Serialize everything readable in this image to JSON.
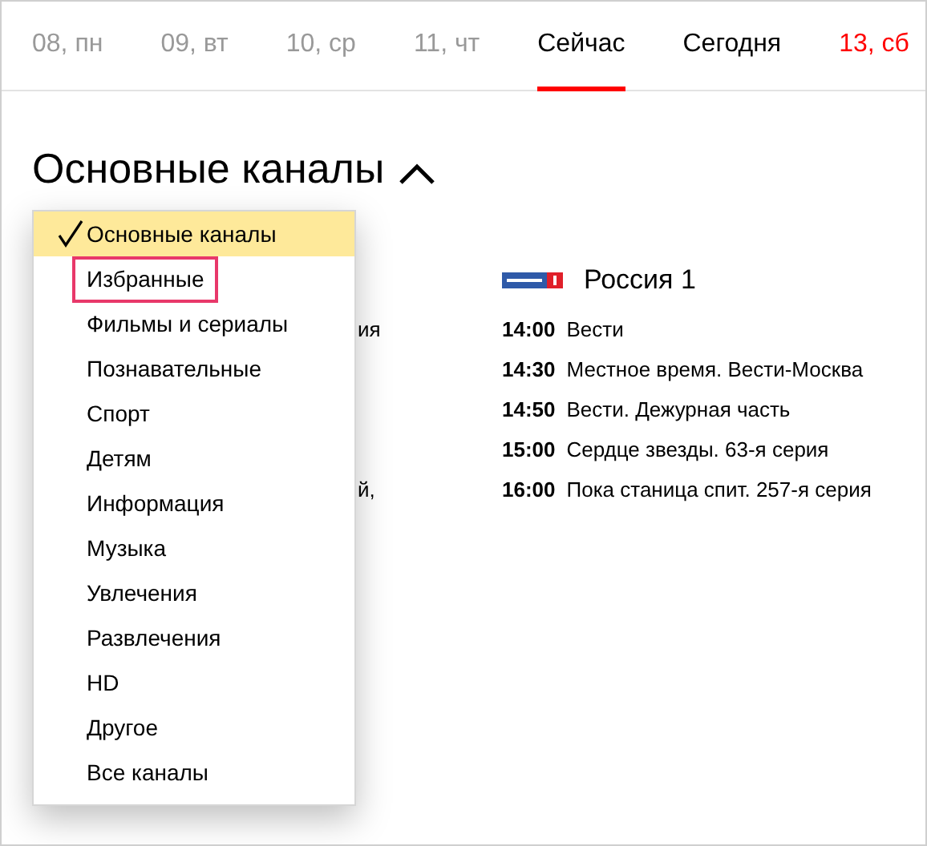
{
  "tabs": [
    {
      "label": "08, пн",
      "kind": "past",
      "selected": false
    },
    {
      "label": "09, вт",
      "kind": "past",
      "selected": false
    },
    {
      "label": "10, ср",
      "kind": "past",
      "selected": false
    },
    {
      "label": "11, чт",
      "kind": "past",
      "selected": false
    },
    {
      "label": "Сейчас",
      "kind": "normal",
      "selected": true
    },
    {
      "label": "Сегодня",
      "kind": "normal",
      "selected": false
    },
    {
      "label": "13, сб",
      "kind": "weekend",
      "selected": false
    }
  ],
  "heading": {
    "title": "Основные каналы",
    "expanded": true
  },
  "dropdown": {
    "items": [
      {
        "label": "Основные каналы",
        "selected": true,
        "outlined": false
      },
      {
        "label": "Избранные",
        "selected": false,
        "outlined": true
      },
      {
        "label": "Фильмы и сериалы",
        "selected": false,
        "outlined": false
      },
      {
        "label": "Познавательные",
        "selected": false,
        "outlined": false
      },
      {
        "label": "Спорт",
        "selected": false,
        "outlined": false
      },
      {
        "label": "Детям",
        "selected": false,
        "outlined": false
      },
      {
        "label": "Информация",
        "selected": false,
        "outlined": false
      },
      {
        "label": "Музыка",
        "selected": false,
        "outlined": false
      },
      {
        "label": "Увлечения",
        "selected": false,
        "outlined": false
      },
      {
        "label": "Развлечения",
        "selected": false,
        "outlined": false
      },
      {
        "label": "HD",
        "selected": false,
        "outlined": false
      },
      {
        "label": "Другое",
        "selected": false,
        "outlined": false
      },
      {
        "label": "Все каналы",
        "selected": false,
        "outlined": false
      }
    ]
  },
  "hidden_column": {
    "rows": [
      "ия",
      "",
      "",
      "",
      "й,"
    ]
  },
  "channel": {
    "name": "Россия 1",
    "programs": [
      {
        "time": "14:00",
        "title": "Вести"
      },
      {
        "time": "14:30",
        "title": "Местное время. Вести-Москва"
      },
      {
        "time": "14:50",
        "title": "Вести. Дежурная часть"
      },
      {
        "time": "15:00",
        "title": "Сердце звезды. 63-я серия"
      },
      {
        "time": "16:00",
        "title": "Пока станица спит. 257-я серия"
      }
    ]
  }
}
